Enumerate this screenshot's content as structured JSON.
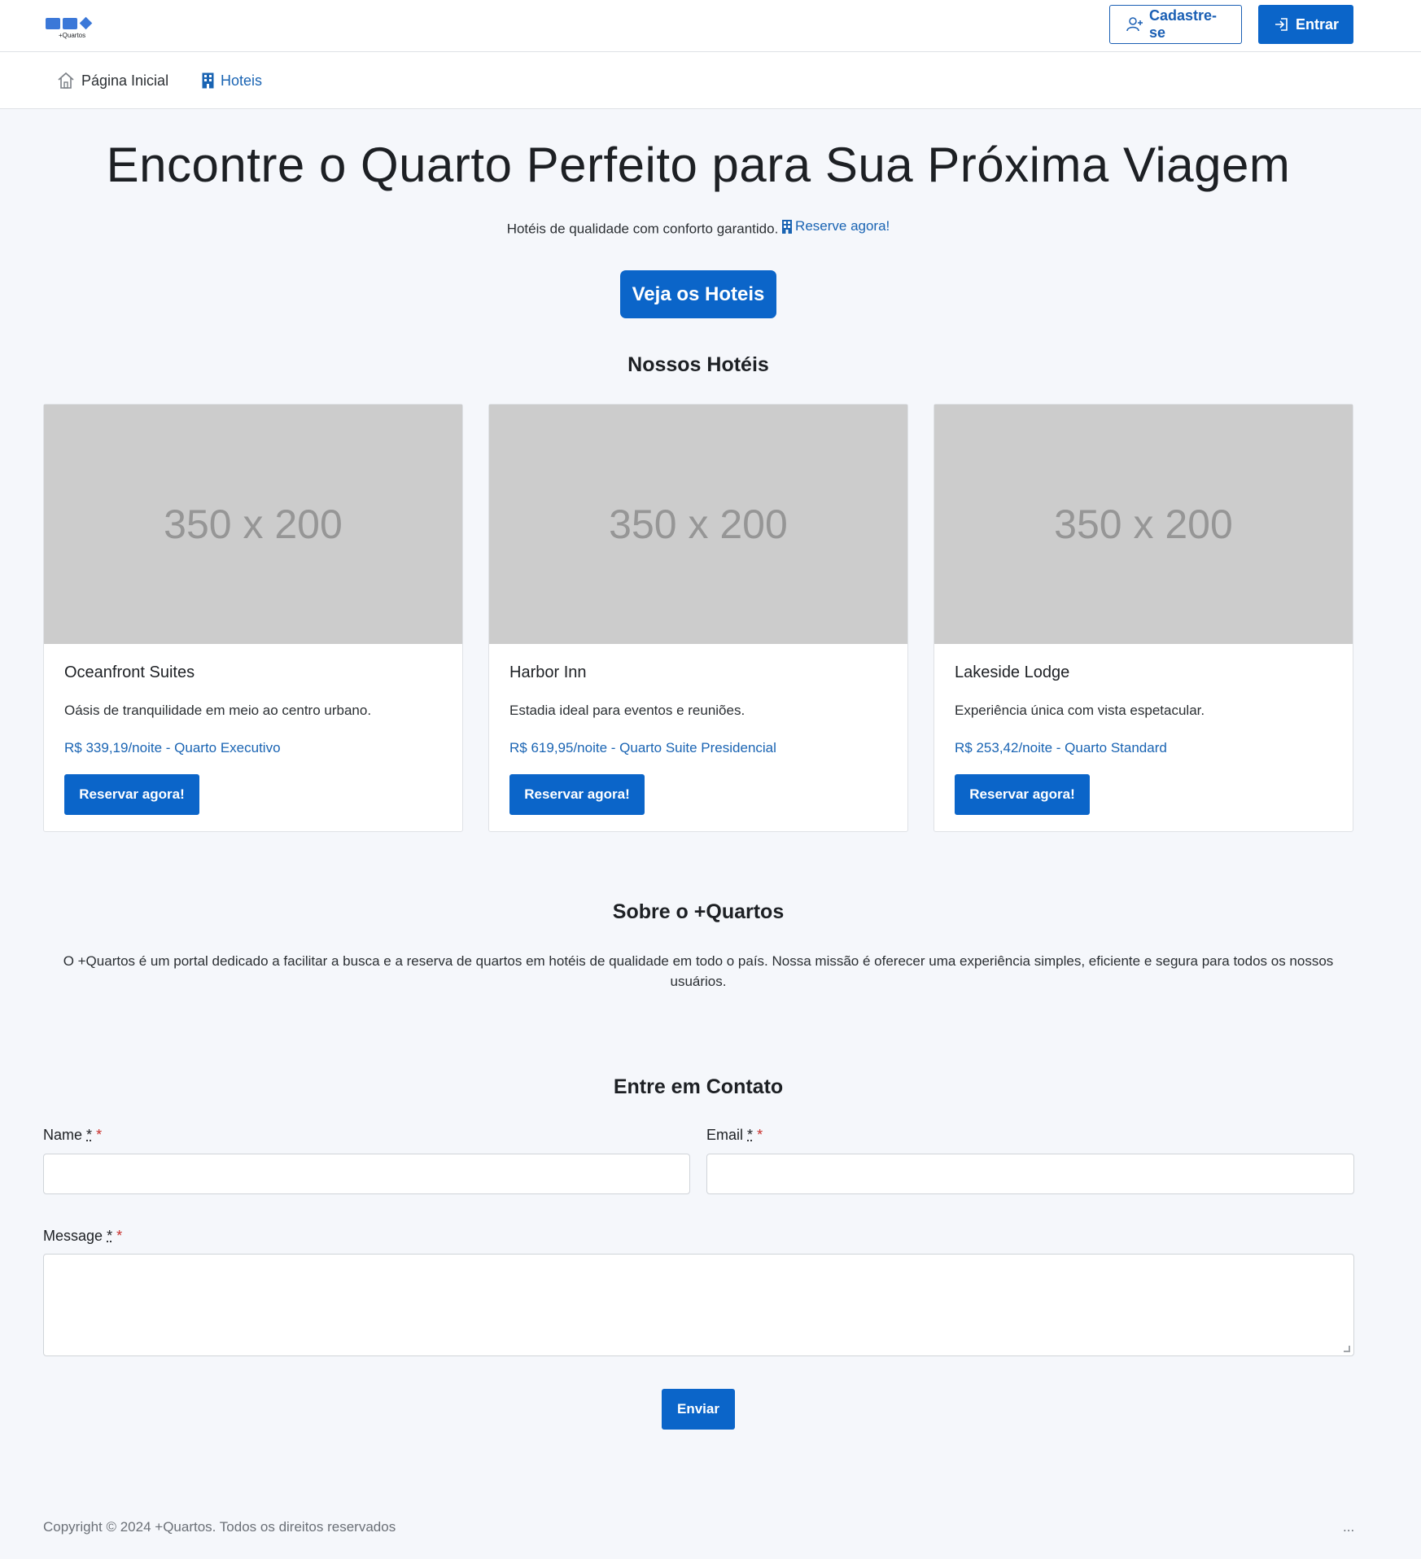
{
  "header": {
    "logo_text": "+Quartos",
    "signup_label": "Cadastre-se",
    "login_label": "Entrar"
  },
  "nav": {
    "home_label": "Página Inicial",
    "hotels_label": "Hoteis"
  },
  "hero": {
    "title": "Encontre o Quarto Perfeito para Sua Próxima Viagem",
    "subtitle": "Hotéis de qualidade com conforto garantido.",
    "subtitle_link": "Reserve agora!",
    "cta_label": "Veja os Hoteis"
  },
  "hotels_section": {
    "title": "Nossos Hotéis",
    "cards": [
      {
        "image_placeholder": "350 x 200",
        "name": "Oceanfront Suites",
        "description": "Oásis de tranquilidade em meio ao centro urbano.",
        "price": "R$ 339,19/noite - Quarto Executivo",
        "button_label": "Reservar agora!"
      },
      {
        "image_placeholder": "350 x 200",
        "name": "Harbor Inn",
        "description": "Estadia ideal para eventos e reuniões.",
        "price": "R$ 619,95/noite - Quarto Suite Presidencial",
        "button_label": "Reservar agora!"
      },
      {
        "image_placeholder": "350 x 200",
        "name": "Lakeside Lodge",
        "description": "Experiência única com vista espetacular.",
        "price": "R$ 253,42/noite - Quarto Standard",
        "button_label": "Reservar agora!"
      }
    ]
  },
  "about": {
    "title": "Sobre o +Quartos",
    "text": "O +Quartos é um portal dedicado a facilitar a busca e a reserva de quartos em hotéis de qualidade em todo o país. Nossa missão é oferecer uma experiência simples, eficiente e segura para todos os nossos usuários."
  },
  "contact": {
    "title": "Entre em Contato",
    "name_label": "Name",
    "email_label": "Email",
    "message_label": "Message",
    "required_abbr": "*",
    "required_mark": "*",
    "name_value": "",
    "email_value": "",
    "message_value": "",
    "submit_label": "Enviar"
  },
  "footer": {
    "copyright": "Copyright © 2024 +Quartos. Todos os direitos reservados",
    "trailing": "..."
  },
  "colors": {
    "primary": "#0b65c9",
    "link": "#1a64b3",
    "background": "#f5f7fb",
    "required": "#c9302c"
  }
}
